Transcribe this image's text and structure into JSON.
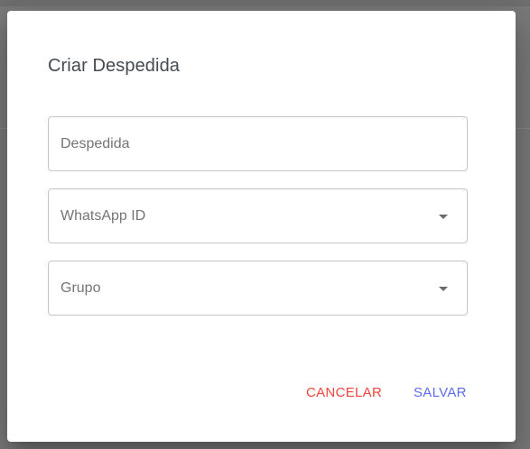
{
  "dialog": {
    "title": "Criar Despedida"
  },
  "fields": {
    "farewell": {
      "placeholder": "Despedida",
      "value": ""
    },
    "whatsapp": {
      "label": "WhatsApp ID",
      "icon": "chevron-down-icon"
    },
    "group": {
      "label": "Grupo",
      "icon": "chevron-down-icon"
    }
  },
  "actions": {
    "cancel_label": "CANCELAR",
    "save_label": "SALVAR"
  },
  "colors": {
    "cancel": "#f1453d",
    "save": "#5b6cf2",
    "overlay": "#7a7a7a"
  }
}
